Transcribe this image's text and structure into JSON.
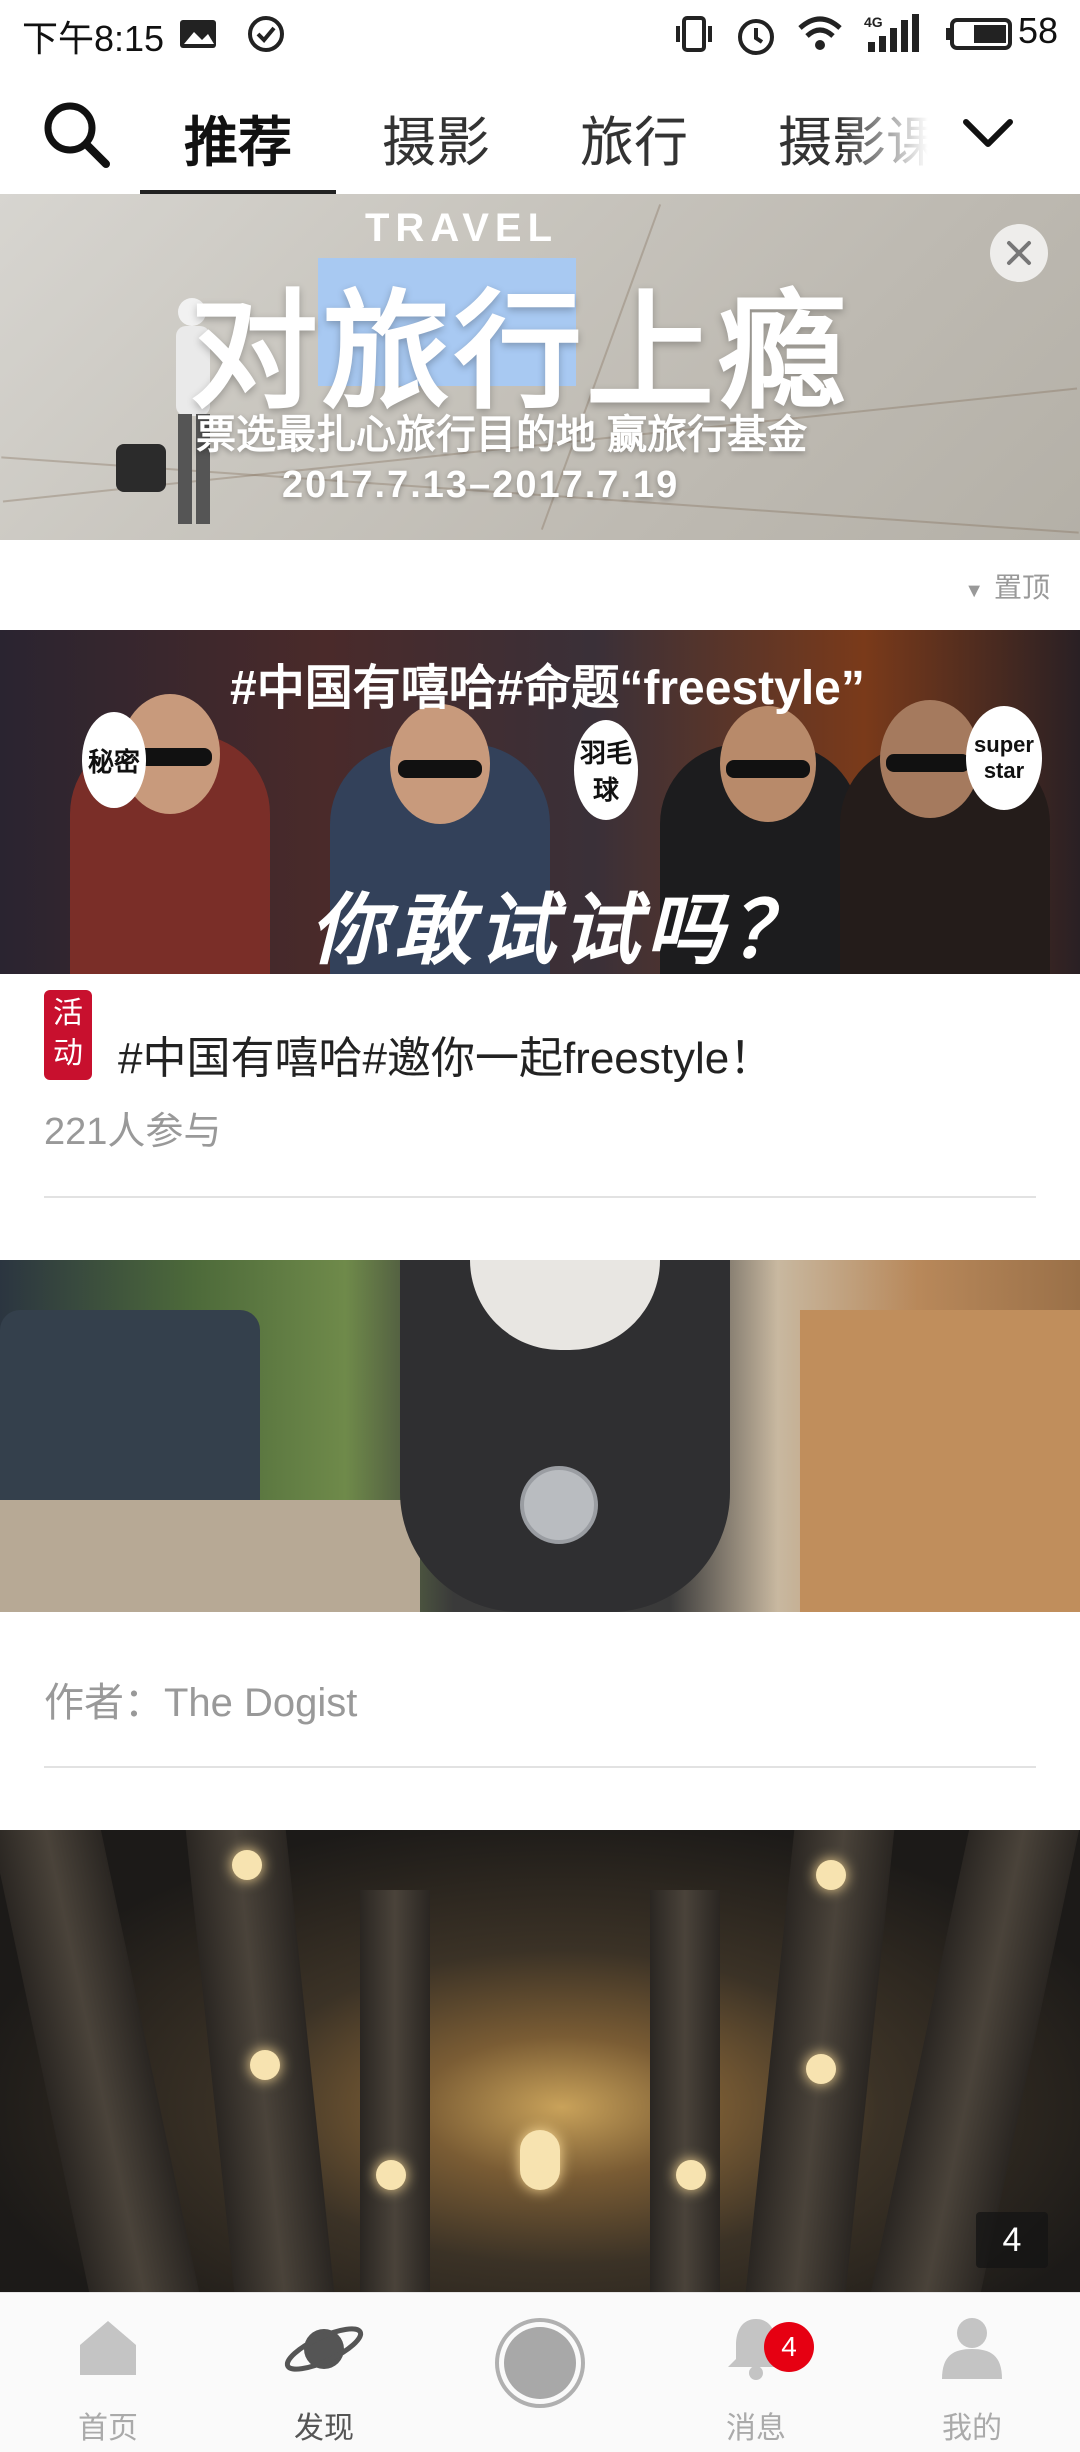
{
  "status_bar": {
    "time": "下午8:15",
    "network": "4G",
    "battery": "58"
  },
  "tabs": {
    "items": [
      {
        "label": "推荐",
        "active": true
      },
      {
        "label": "摄影"
      },
      {
        "label": "旅行"
      },
      {
        "label": "摄影课"
      }
    ]
  },
  "banner": {
    "kicker": "TRAVEL",
    "title_part1": "对",
    "title_highlight": "旅行",
    "title_part2": "上瘾",
    "subtitle": "票选最扎心旅行目的地 赢旅行基金",
    "dates": "2017.7.13–2017.7.19",
    "pinned_label": "置顶"
  },
  "promo": {
    "image_title": "#中国有嘻哈#命题“freestyle”",
    "bubble_1": "秘密",
    "bubble_2": "羽毛球",
    "bubble_3": "super star",
    "script_text": "你敢试试吗？",
    "badge": "活动",
    "title": "#中国有嘻哈#邀你一起freestyle！",
    "participants": "221人参与"
  },
  "post": {
    "author": "作者：The Dogist"
  },
  "gallery": {
    "count": "4"
  },
  "bottom_nav": {
    "items": [
      {
        "label": "首页"
      },
      {
        "label": "发现",
        "active": true
      },
      {
        "label": ""
      },
      {
        "label": "消息",
        "badge": "4"
      },
      {
        "label": "我的"
      }
    ]
  },
  "colors": {
    "accent": "#c8102e",
    "badge": "#e60012",
    "highlight": "#a8c9f2"
  }
}
